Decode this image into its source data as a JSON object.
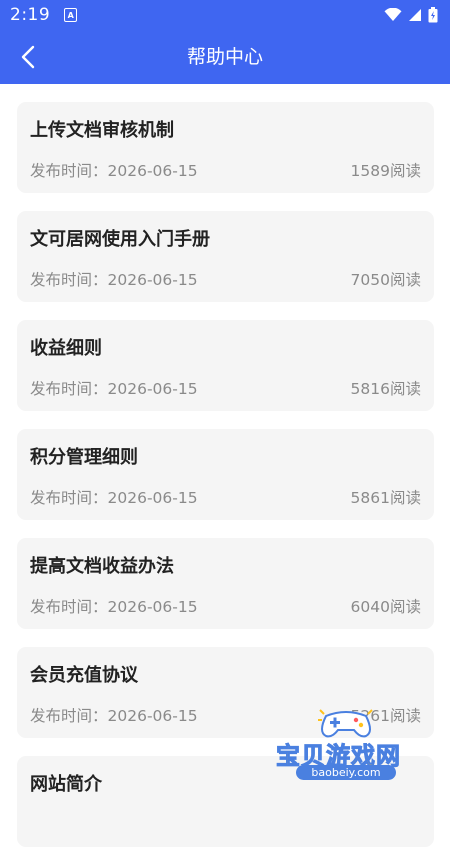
{
  "status": {
    "time": "2:19",
    "notif_glyph": "A",
    "icons": [
      "wifi-icon",
      "signal-icon",
      "battery-icon"
    ]
  },
  "header": {
    "title": "帮助中心",
    "back_icon": "chevron-left-icon"
  },
  "colors": {
    "primary": "#3f66f1",
    "card_bg": "#f5f5f5",
    "meta_text": "#8a8a8a"
  },
  "articles": [
    {
      "title": "上传文档审核机制",
      "date": "发布时间：2026-06-15",
      "reads": "1589阅读"
    },
    {
      "title": "文可居网使用入门手册",
      "date": "发布时间：2026-06-15",
      "reads": "7050阅读"
    },
    {
      "title": "收益细则",
      "date": "发布时间：2026-06-15",
      "reads": "5816阅读"
    },
    {
      "title": "积分管理细则",
      "date": "发布时间：2026-06-15",
      "reads": "5861阅读"
    },
    {
      "title": "提高文档收益办法",
      "date": "发布时间：2026-06-15",
      "reads": "6040阅读"
    },
    {
      "title": "会员充值协议",
      "date": "发布时间：2026-06-15",
      "reads": "5261阅读"
    },
    {
      "title": "网站简介",
      "date": "",
      "reads": ""
    }
  ],
  "watermark": {
    "name": "宝贝游戏网",
    "url": "baobeiy.com"
  }
}
